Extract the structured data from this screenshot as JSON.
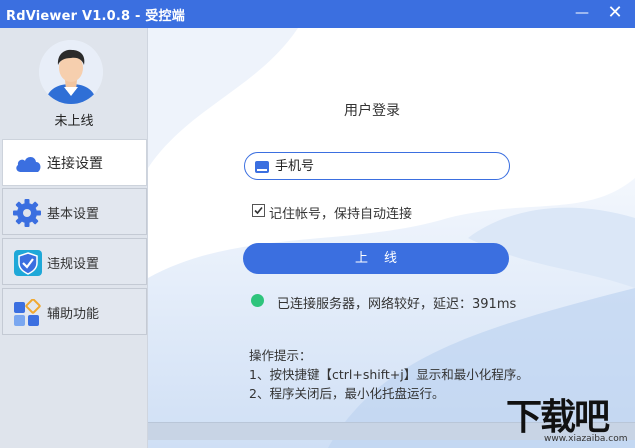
{
  "window": {
    "title": "RdViewer V1.0.8 - 受控端",
    "minimize_label": "—",
    "close_label": "✕"
  },
  "sidebar": {
    "status": "未上线",
    "items": [
      {
        "label": "连接设置",
        "icon": "cloud-icon",
        "active": true
      },
      {
        "label": "基本设置",
        "icon": "gear-icon",
        "active": false
      },
      {
        "label": "违规设置",
        "icon": "shield-check-icon",
        "active": false
      },
      {
        "label": "辅助功能",
        "icon": "apps-grid-icon",
        "active": false
      }
    ]
  },
  "login": {
    "title": "用户登录",
    "phone_placeholder": "手机号",
    "phone_value": "",
    "remember_checked": true,
    "remember_label": "记住帐号，保持自动连接",
    "online_button": "上线"
  },
  "connection": {
    "status_text": "已连接服务器，网络较好，延迟：391ms",
    "status_color": "#2ec47c"
  },
  "tips": {
    "heading": "操作提示：",
    "lines": [
      "1、按快捷键【ctrl+shift+j】显示和最小化程序。",
      "2、程序关闭后，最小化托盘运行。"
    ]
  },
  "watermark": {
    "brand": "下载吧",
    "url": "www.xiazaiba.com"
  },
  "colors": {
    "accent": "#3b6fe0",
    "sidebar_bg": "#dfe4ec"
  }
}
